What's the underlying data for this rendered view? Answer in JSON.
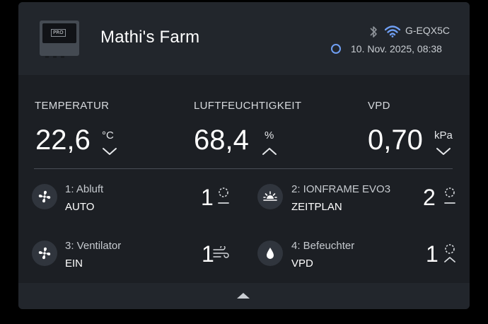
{
  "header": {
    "title": "Mathi's Farm",
    "device_label": "PRO",
    "device_id": "G-EQX5C",
    "datetime": "10. Nov. 2025, 08:38",
    "status_color": "#6f9ef2",
    "wifi_color": "#6f9ef2"
  },
  "metrics": [
    {
      "label": "TEMPERATUR",
      "value": "22,6",
      "unit": "°C",
      "trend": "down"
    },
    {
      "label": "LUFTFEUCHTIGKEIT",
      "value": "68,4",
      "unit": "%",
      "trend": "up"
    },
    {
      "label": "VPD",
      "value": "0,70",
      "unit": "kPa",
      "trend": "down"
    }
  ],
  "outlets": [
    {
      "name": "1: Abluft",
      "mode": "AUTO",
      "level": "1",
      "icon": "fan-icon",
      "indicator": "standby-icon"
    },
    {
      "name": "2: IONFRAME EVO3",
      "mode": "ZEITPLAN",
      "level": "2",
      "icon": "sunrise-icon",
      "indicator": "standby-icon"
    },
    {
      "name": "3: Ventilator",
      "mode": "EIN",
      "level": "1",
      "icon": "fan-icon",
      "indicator": "wind-icon"
    },
    {
      "name": "4: Befeuchter",
      "mode": "VPD",
      "level": "1",
      "icon": "droplet-icon",
      "indicator": "standby-up-icon"
    }
  ],
  "footer": {
    "icon": "collapse-arrow-icon"
  }
}
